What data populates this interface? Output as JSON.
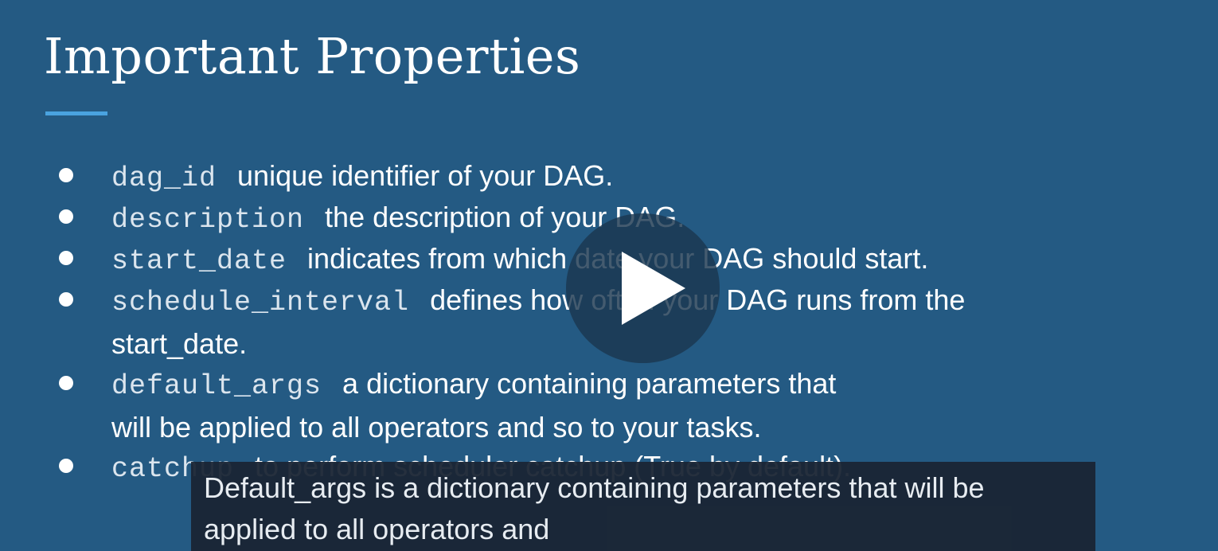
{
  "slide": {
    "title": "Important Properties",
    "accent_color": "#4aa3e0",
    "background_color": "#245a83",
    "bullets": [
      {
        "code": "dag_id",
        "text": "unique identifier of your DAG.",
        "text2": ""
      },
      {
        "code": "description",
        "text": "the description of your DAG.",
        "text2": ""
      },
      {
        "code": "start_date",
        "text": "indicates from which date your DAG should start.",
        "text2": ""
      },
      {
        "code": "schedule_interval",
        "text": "defines how often your DAG runs from the",
        "text2": "start_date."
      },
      {
        "code": "default_args",
        "text": "a dictionary containing parameters that",
        "text2": "will be applied to all operators and so to your tasks."
      },
      {
        "code": "catchup",
        "text": "to perform scheduler catchup (True by default).",
        "text2": ""
      }
    ]
  },
  "player": {
    "play_button_icon": "play-icon"
  },
  "captions": {
    "line1": "Default_args is a dictionary containing parameters that will be",
    "line2": "applied to all operators and"
  }
}
